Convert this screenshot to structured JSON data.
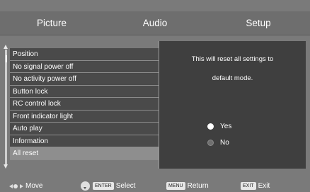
{
  "tabs": [
    "Picture",
    "Audio",
    "Setup"
  ],
  "menu": {
    "items": [
      {
        "label": "Position"
      },
      {
        "label": "No signal power off"
      },
      {
        "label": "No activity power off"
      },
      {
        "label": "Button lock"
      },
      {
        "label": "RC control lock"
      },
      {
        "label": "Front indicator light"
      },
      {
        "label": "Auto play"
      },
      {
        "label": "Information"
      },
      {
        "label": "All reset"
      }
    ],
    "selected_index": 8
  },
  "dialog": {
    "message_line1": "This will reset all settings to",
    "message_line2": "default mode.",
    "options": [
      {
        "label": "Yes",
        "selected": true
      },
      {
        "label": "No",
        "selected": false
      }
    ]
  },
  "footer": {
    "move": "Move",
    "enter_key": "ENTER",
    "select": "Select",
    "menu_key": "MENU",
    "return": "Return",
    "exit_key": "EXIT",
    "exit": "Exit"
  }
}
